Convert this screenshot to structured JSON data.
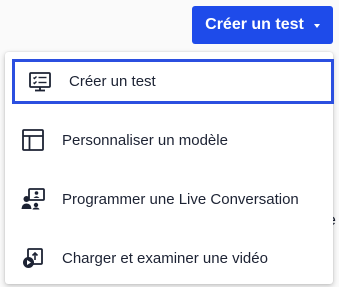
{
  "header": {
    "create_button_label": "Créer un test"
  },
  "menu": {
    "items": [
      {
        "label": "Créer un test",
        "icon": "test-monitor-icon"
      },
      {
        "label": "Personnaliser un modèle",
        "icon": "template-layout-icon"
      },
      {
        "label": "Programmer une Live Conversation",
        "icon": "live-conversation-icon"
      },
      {
        "label": "Charger et examiner une vidéo",
        "icon": "upload-video-icon"
      }
    ]
  },
  "background": {
    "partial_text": "e"
  },
  "colors": {
    "accent": "#1e4bea",
    "focus_ring": "#2b4fe0",
    "text": "#1c2233"
  }
}
